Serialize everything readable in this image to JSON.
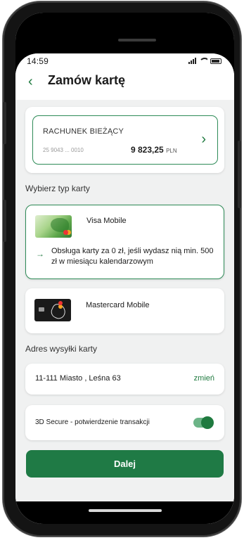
{
  "status_bar": {
    "time": "14:59"
  },
  "header": {
    "back_icon": "chevron-left-icon",
    "title": "Zamów kartę"
  },
  "account": {
    "name": "RACHUNEK BIEŻĄCY",
    "number": "25 9043 ... 0010",
    "balance": "9 823,25",
    "currency": "PLN"
  },
  "card_type_section": {
    "label": "Wybierz typ karty"
  },
  "cards": [
    {
      "title": "Visa Mobile",
      "description": "Obsługa karty za 0 zł, jeśli wydasz nią min. 500 zł w miesiącu kalendarzowym",
      "selected": true
    },
    {
      "title": "Mastercard Mobile",
      "selected": false
    }
  ],
  "address_section": {
    "label": "Adres wysyłki karty",
    "address": "11-111 Miasto , Leśna  63",
    "change_label": "zmień"
  },
  "secure": {
    "label": "3D Secure - potwierdzenie transakcji",
    "enabled": true
  },
  "actions": {
    "next_label": "Dalej"
  },
  "colors": {
    "accent": "#1f7a45",
    "background": "#f0f1f1",
    "text": "#1b1b1b"
  }
}
